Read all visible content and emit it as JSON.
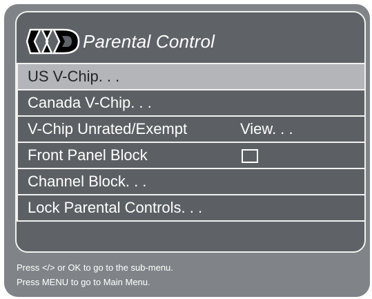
{
  "title": "Parental Control",
  "logo": {
    "icon": "parental-control-logo"
  },
  "menu": {
    "items": [
      {
        "label": "US V-Chip. . .",
        "selected": true
      },
      {
        "label": "Canada V-Chip. . .",
        "selected": false
      },
      {
        "label": "V-Chip Unrated/Exempt",
        "value": "View. . .",
        "selected": false
      },
      {
        "label": "Front Panel Block",
        "checked": false,
        "selected": false
      },
      {
        "label": "Channel Block. . .",
        "selected": false
      },
      {
        "label": "Lock Parental Controls. . .",
        "selected": false
      }
    ]
  },
  "help": {
    "line1": "Press </> or OK to go to the sub-menu.",
    "line2": "Press MENU to go to Main Menu."
  },
  "colors": {
    "panel": "#808488",
    "frame": "#5f6368",
    "highlight": "#b3b5b9",
    "text": "#ffffff"
  }
}
